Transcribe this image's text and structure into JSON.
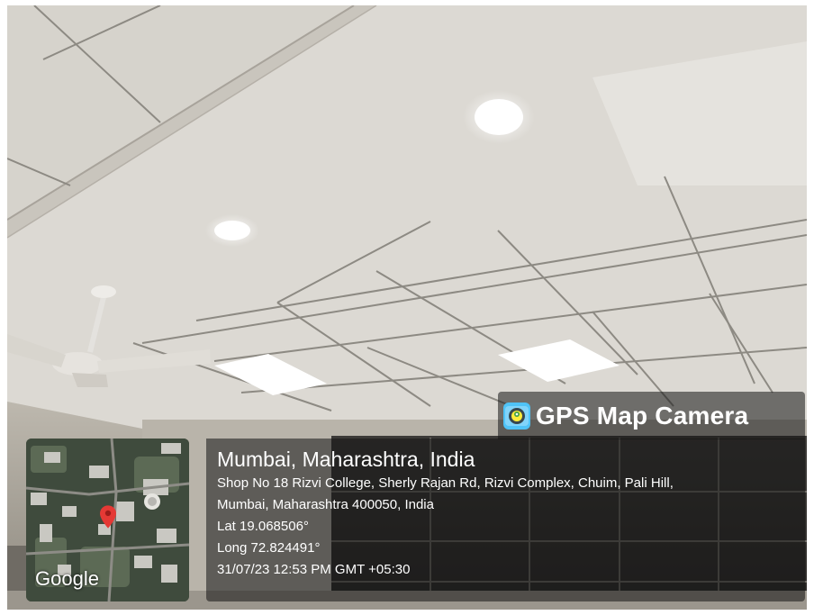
{
  "watermark": {
    "app_name": "GPS Map Camera",
    "icon": "gps-map-camera-app-icon"
  },
  "map": {
    "provider_label": "Google",
    "pin_icon": "location-pin-icon",
    "pin_color": "#e53935"
  },
  "location": {
    "city_line": "Mumbai, Maharashtra, India",
    "address_line_1": "Shop No 18 Rizvi College, Sherly Rajan Rd, Rizvi Complex, Chuim, Pali Hill,",
    "address_line_2": "Mumbai, Maharashtra 400050, India",
    "latitude": "Lat 19.068506°",
    "longitude": "Long 72.824491°",
    "timestamp": "31/07/23 12:53 PM GMT +05:30"
  },
  "scene": {
    "subject": "office ceiling with tiles, lights and fan",
    "ceiling_color": "#dedbd6",
    "grid_color": "#8a8780",
    "light_color": "#ffffff"
  }
}
